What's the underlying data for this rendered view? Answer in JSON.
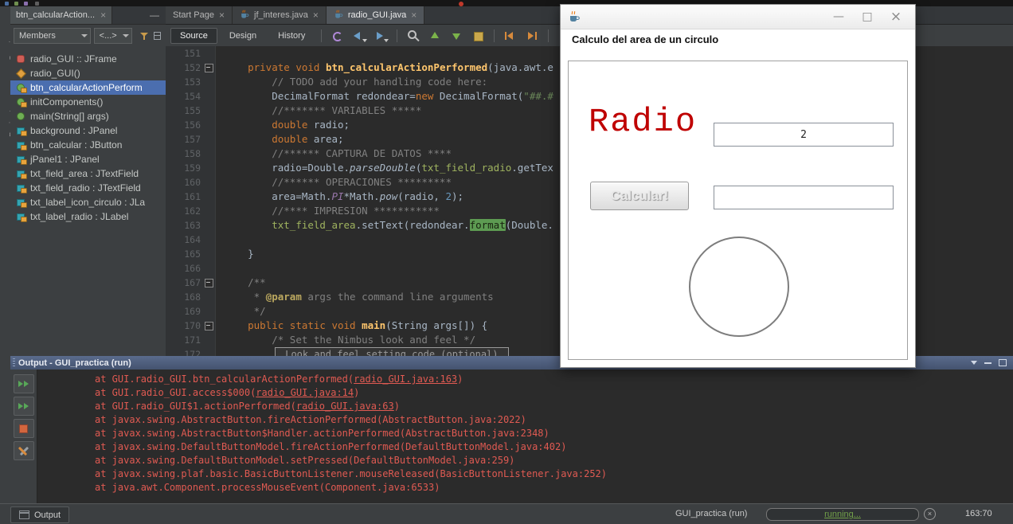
{
  "left_rail": {
    "tabs": [
      "Services",
      "Projects"
    ]
  },
  "navigator": {
    "tab": {
      "title": "btn_calcularAction...",
      "close": "×"
    },
    "minimize": "—",
    "members_combo": "Members",
    "filter_combo": "<...>",
    "tree": [
      {
        "icon": "class-icon",
        "label": "radio_GUI :: JFrame",
        "selected": false
      },
      {
        "icon": "constructor-icon",
        "label": "radio_GUI()",
        "selected": false
      },
      {
        "icon": "method-private-icon",
        "label": "btn_calcularActionPerform",
        "selected": true
      },
      {
        "icon": "method-private-icon",
        "label": "initComponents()",
        "selected": false
      },
      {
        "icon": "method-public-icon",
        "label": "main(String[] args)",
        "selected": false
      },
      {
        "icon": "field-private-icon",
        "label": "background : JPanel",
        "selected": false
      },
      {
        "icon": "field-private-icon",
        "label": "btn_calcular : JButton",
        "selected": false
      },
      {
        "icon": "field-private-icon",
        "label": "jPanel1 : JPanel",
        "selected": false
      },
      {
        "icon": "field-private-icon",
        "label": "txt_field_area : JTextField",
        "selected": false
      },
      {
        "icon": "field-private-icon",
        "label": "txt_field_radio : JTextField",
        "selected": false
      },
      {
        "icon": "field-private-icon",
        "label": "txt_label_icon_circulo : JLa",
        "selected": false
      },
      {
        "icon": "field-private-icon",
        "label": "txt_label_radio : JLabel",
        "selected": false
      }
    ]
  },
  "editor": {
    "tabs": [
      {
        "label": "Start Page",
        "close": "×",
        "active": false,
        "java": false
      },
      {
        "label": "jf_interes.java",
        "close": "×",
        "active": false,
        "java": true
      },
      {
        "label": "radio_GUI.java",
        "close": "×",
        "active": true,
        "java": true
      }
    ],
    "toolbar": {
      "source": "Source",
      "design": "Design",
      "history": "History",
      "icons": [
        "last-edit-icon",
        "back-icon",
        "forward-icon",
        "find-icon",
        "prev-occurrence-icon",
        "next-occurrence-icon",
        "toggle-highlight-icon",
        "shift-left-icon",
        "shift-right-icon",
        "comment-icon",
        "uncomment-icon",
        "up-icon"
      ]
    },
    "code": {
      "lines": [
        {
          "n": 151,
          "segs": []
        },
        {
          "n": 152,
          "fold": true,
          "segs": [
            {
              "t": "    ",
              "c": "p"
            },
            {
              "t": "private void ",
              "c": "k"
            },
            {
              "t": "btn_calcularActionPerformed",
              "c": "m"
            },
            {
              "t": "(java.awt.e",
              "c": "p"
            }
          ]
        },
        {
          "n": 153,
          "segs": [
            {
              "t": "        ",
              "c": "p"
            },
            {
              "t": "// TODO add your handling code here:",
              "c": "c"
            }
          ]
        },
        {
          "n": 154,
          "segs": [
            {
              "t": "        DecimalFormat redondear=",
              "c": "p"
            },
            {
              "t": "new",
              "c": "k"
            },
            {
              "t": " DecimalFormat(",
              "c": "p"
            },
            {
              "t": "\"##.#",
              "c": "s"
            }
          ]
        },
        {
          "n": 155,
          "segs": [
            {
              "t": "        ",
              "c": "p"
            },
            {
              "t": "//******* VARIABLES *****",
              "c": "c"
            }
          ]
        },
        {
          "n": 156,
          "segs": [
            {
              "t": "        ",
              "c": "p"
            },
            {
              "t": "double",
              "c": "k"
            },
            {
              "t": " radio;",
              "c": "p"
            }
          ]
        },
        {
          "n": 157,
          "segs": [
            {
              "t": "        ",
              "c": "p"
            },
            {
              "t": "double",
              "c": "k"
            },
            {
              "t": " area;",
              "c": "p"
            }
          ]
        },
        {
          "n": 158,
          "segs": [
            {
              "t": "        ",
              "c": "p"
            },
            {
              "t": "//****** CAPTURA DE DATOS ****",
              "c": "c"
            }
          ]
        },
        {
          "n": 159,
          "segs": [
            {
              "t": "        radio=Double.",
              "c": "p"
            },
            {
              "t": "parseDouble",
              "c": "sm"
            },
            {
              "t": "(",
              "c": "p"
            },
            {
              "t": "txt_field_radio",
              "c": "f"
            },
            {
              "t": ".getTex",
              "c": "p"
            }
          ]
        },
        {
          "n": 160,
          "segs": [
            {
              "t": "        ",
              "c": "p"
            },
            {
              "t": "//****** OPERACIONES *********",
              "c": "c"
            }
          ]
        },
        {
          "n": 161,
          "segs": [
            {
              "t": "        area=Math.",
              "c": "p"
            },
            {
              "t": "PI",
              "c": "sf"
            },
            {
              "t": "*Math.",
              "c": "p"
            },
            {
              "t": "pow",
              "c": "sm"
            },
            {
              "t": "(radio, ",
              "c": "p"
            },
            {
              "t": "2",
              "c": "n"
            },
            {
              "t": ");",
              "c": "p"
            }
          ]
        },
        {
          "n": 162,
          "segs": [
            {
              "t": "        ",
              "c": "p"
            },
            {
              "t": "//**** IMPRESION ***********",
              "c": "c"
            }
          ]
        },
        {
          "n": 163,
          "segs": [
            {
              "t": "        ",
              "c": "p"
            },
            {
              "t": "txt_field_area",
              "c": "f"
            },
            {
              "t": ".setText(redondear.",
              "c": "p"
            },
            {
              "t": "format",
              "c": "hl"
            },
            {
              "t": "(Double.",
              "c": "p"
            }
          ]
        },
        {
          "n": 164,
          "segs": []
        },
        {
          "n": 165,
          "segs": [
            {
              "t": "    }",
              "c": "p"
            }
          ]
        },
        {
          "n": 166,
          "segs": []
        },
        {
          "n": 167,
          "fold": true,
          "segs": [
            {
              "t": "    ",
              "c": "p"
            },
            {
              "t": "/**",
              "c": "c"
            }
          ]
        },
        {
          "n": 168,
          "segs": [
            {
              "t": "     * ",
              "c": "c"
            },
            {
              "t": "@param",
              "c": "jd"
            },
            {
              "t": " args the command line arguments",
              "c": "c"
            }
          ]
        },
        {
          "n": 169,
          "segs": [
            {
              "t": "     */",
              "c": "c"
            }
          ]
        },
        {
          "n": 170,
          "fold": true,
          "segs": [
            {
              "t": "    ",
              "c": "p"
            },
            {
              "t": "public static void ",
              "c": "k"
            },
            {
              "t": "main",
              "c": "m"
            },
            {
              "t": "(String args[]) {",
              "c": "p"
            }
          ]
        },
        {
          "n": 171,
          "segs": [
            {
              "t": "        ",
              "c": "p"
            },
            {
              "t": "/* Set the Nimbus look and feel */",
              "c": "c"
            }
          ]
        },
        {
          "n": 172,
          "segs": [
            {
              "t": "        ",
              "c": "p"
            }
          ],
          "box": "Look and feel setting code (optional)"
        }
      ]
    }
  },
  "app_window": {
    "controls": {
      "minimize": "—",
      "maximize": "□",
      "close": "×"
    },
    "header": "Calculo del area de un circulo",
    "radio_label": "Radio",
    "radio_value": "2",
    "button_label": "Calcular!",
    "area_value": ""
  },
  "output": {
    "title": "Output - GUI_practica (run)",
    "lines": [
      [
        {
          "t": "at GUI.radio_GUI.btn_calcularActionPerformed(",
          "c": "p"
        },
        {
          "t": "radio_GUI.java:163",
          "c": "l"
        },
        {
          "t": ")",
          "c": "p"
        }
      ],
      [
        {
          "t": "at GUI.radio_GUI.access$000(",
          "c": "p"
        },
        {
          "t": "radio_GUI.java:14",
          "c": "l"
        },
        {
          "t": ")",
          "c": "p"
        }
      ],
      [
        {
          "t": "at GUI.radio_GUI$1.actionPerformed(",
          "c": "p"
        },
        {
          "t": "radio_GUI.java:63",
          "c": "l"
        },
        {
          "t": ")",
          "c": "p"
        }
      ],
      [
        {
          "t": "at javax.swing.AbstractButton.fireActionPerformed(AbstractButton.java:2022)",
          "c": "p"
        }
      ],
      [
        {
          "t": "at javax.swing.AbstractButton$Handler.actionPerformed(AbstractButton.java:2348)",
          "c": "p"
        }
      ],
      [
        {
          "t": "at javax.swing.DefaultButtonModel.fireActionPerformed(DefaultButtonModel.java:402)",
          "c": "p"
        }
      ],
      [
        {
          "t": "at javax.swing.DefaultButtonModel.setPressed(DefaultButtonModel.java:259)",
          "c": "p"
        }
      ],
      [
        {
          "t": "at javax.swing.plaf.basic.BasicButtonListener.mouseReleased(BasicButtonListener.java:252)",
          "c": "p"
        }
      ],
      [
        {
          "t": "at java.awt.Component.processMouseEvent(Component.java:6533)",
          "c": "p"
        }
      ]
    ]
  },
  "statusbar": {
    "tab": "Output",
    "process": "GUI_practica (run)",
    "progress": "running...",
    "caret": "163:70"
  },
  "colors": {
    "selection_blue": "#4b6eaf",
    "error_red": "#e05a52",
    "running_green": "#72a149",
    "radio_red": "#bf0000"
  }
}
